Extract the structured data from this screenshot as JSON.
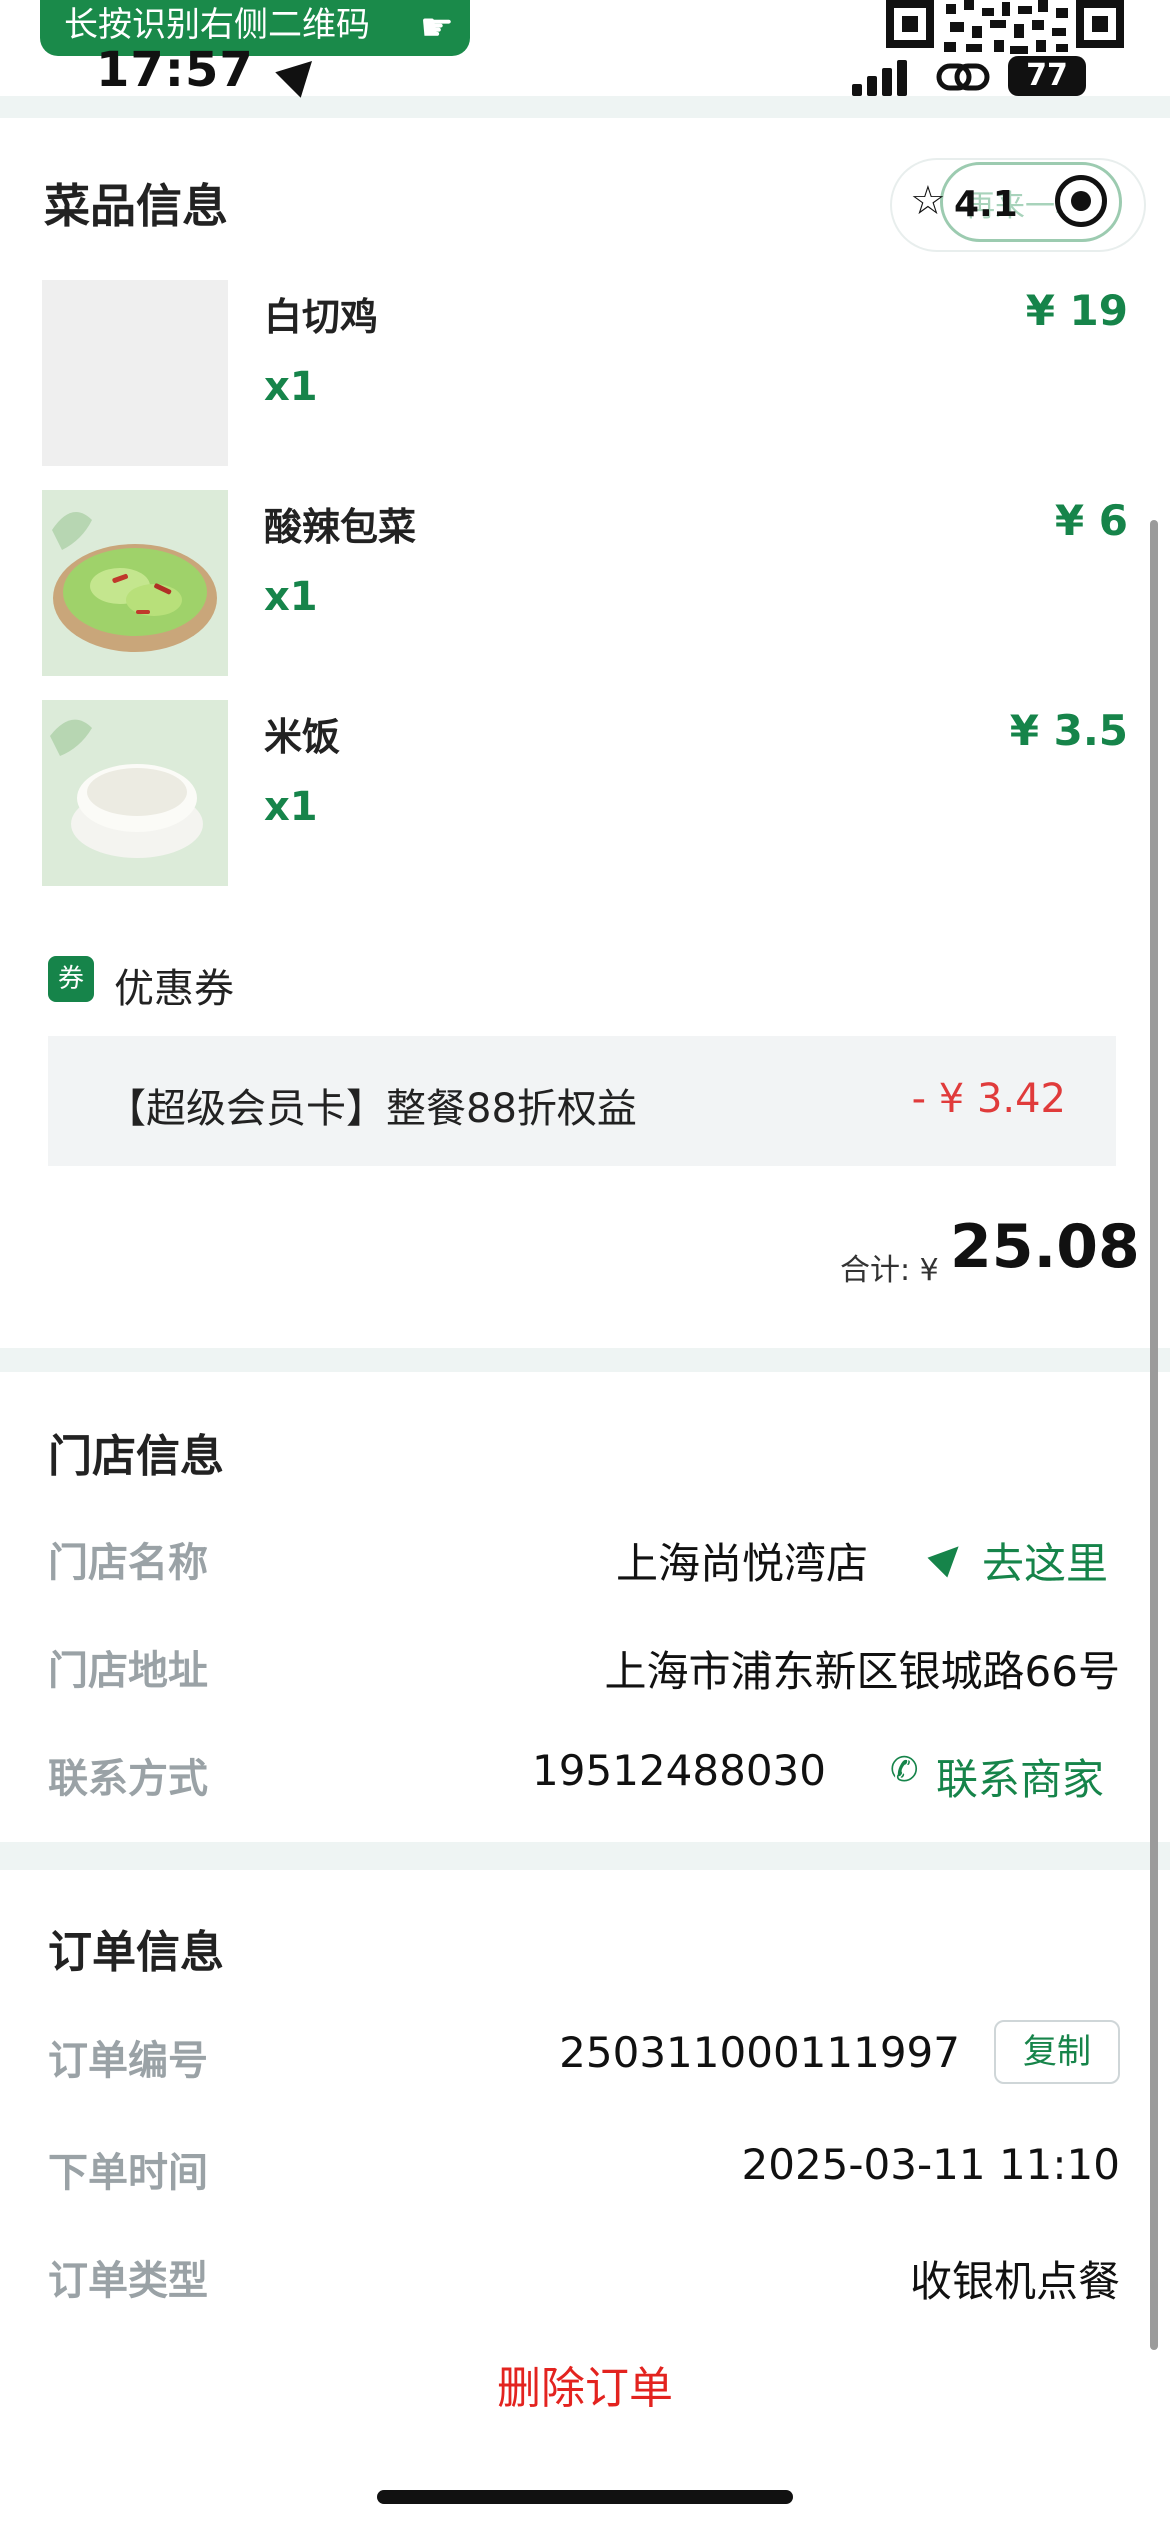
{
  "status_bar": {
    "qr_hint": "长按识别右侧二维码",
    "time": "17:57",
    "battery": "77"
  },
  "dishes_section": {
    "title": "菜品信息",
    "rating": "4.1",
    "reorder": "再来一单",
    "items": [
      {
        "name": "白切鸡",
        "qty": "x1",
        "price": "¥ 19",
        "image": "placeholder-gray"
      },
      {
        "name": "酸辣包菜",
        "qty": "x1",
        "price": "¥ 6",
        "image": "cabbage-bowl"
      },
      {
        "name": "米饭",
        "qty": "x1",
        "price": "¥ 3.5",
        "image": "rice-bowl"
      }
    ],
    "coupon": {
      "badge": "券",
      "label": "优惠券",
      "name": "【超级会员卡】整餐88折权益",
      "amount": "- ¥ 3.42"
    },
    "total": {
      "label": "合计: ¥",
      "value": "25.08"
    }
  },
  "store_section": {
    "title": "门店信息",
    "name_label": "门店名称",
    "name_value": "上海尚悦湾店",
    "goto": "去这里",
    "address_label": "门店地址",
    "address_value": "上海市浦东新区银城路66号",
    "contact_label": "联系方式",
    "contact_value": "19512488030",
    "contact_action": "联系商家"
  },
  "order_section": {
    "title": "订单信息",
    "number_label": "订单编号",
    "number_value": "250311000111997",
    "copy": "复制",
    "time_label": "下单时间",
    "time_value": "2025-03-11 11:10",
    "type_label": "订单类型",
    "type_value": "收银机点餐"
  },
  "delete_order": "删除订单",
  "colors": {
    "accent": "#16844a",
    "discount": "#e03b3b",
    "danger": "#e3231f"
  }
}
